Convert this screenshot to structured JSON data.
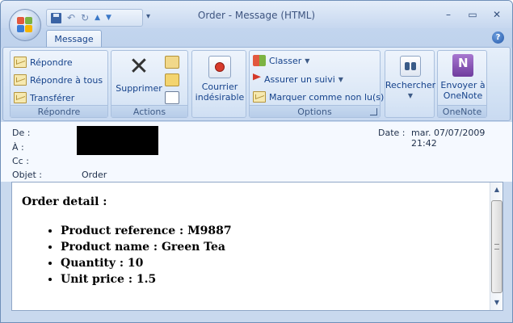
{
  "window": {
    "title": "Order - Message (HTML)",
    "controls": [
      "–",
      "▭",
      "✕"
    ]
  },
  "quick_access": {
    "undo": "↶",
    "redo": "↻",
    "up": "▲",
    "down": "▼",
    "more": "▾"
  },
  "tabs": [
    {
      "label": "Message"
    }
  ],
  "help_label": "?",
  "ribbon": {
    "repondre": {
      "label": "Répondre",
      "buttons": [
        "Répondre",
        "Répondre à tous",
        "Transférer"
      ]
    },
    "actions": {
      "label": "Actions",
      "delete_label": "Supprimer"
    },
    "junk": {
      "label_line1": "Courrier",
      "label_line2": "indésirable"
    },
    "options": {
      "label": "Options",
      "buttons": [
        "Classer",
        "Assurer un suivi",
        "Marquer comme non lu(s)"
      ]
    },
    "find": {
      "label": "Rechercher"
    },
    "onenote": {
      "label": "OneNote",
      "button_line1": "Envoyer à",
      "button_line2": "OneNote"
    }
  },
  "headers": {
    "from_label": "De :",
    "to_label": "À :",
    "cc_label": "Cc :",
    "subject_label": "Objet :",
    "subject_value": "Order",
    "date_label": "Date :",
    "date_value": "mar. 07/07/2009 21:42"
  },
  "message": {
    "heading": "Order detail :",
    "items": [
      "Product reference : M9887",
      "Product name : Green Tea",
      "Quantity : 10",
      "Unit price : 1.5"
    ]
  },
  "colors": {
    "accent": "#15428b",
    "ribbon": "#dbe7f6",
    "frame": "#c9d9ee"
  }
}
